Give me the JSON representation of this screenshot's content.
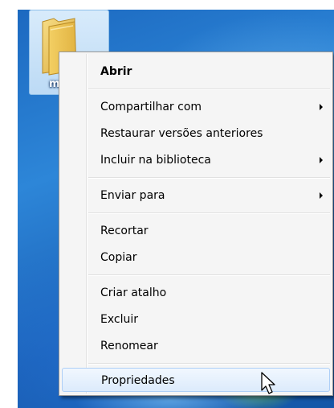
{
  "desktop": {
    "folder_label": "mú",
    "folder_icon": "folder-icon"
  },
  "menu": {
    "items": [
      {
        "label": "Abrir",
        "bold": true
      },
      {
        "label": "Compartilhar com",
        "submenu": true
      },
      {
        "label": "Restaurar versões anteriores"
      },
      {
        "label": "Incluir na biblioteca",
        "submenu": true
      },
      {
        "label": "Enviar para",
        "submenu": true
      },
      {
        "label": "Recortar"
      },
      {
        "label": "Copiar"
      },
      {
        "label": "Criar atalho"
      },
      {
        "label": "Excluir"
      },
      {
        "label": "Renomear"
      },
      {
        "label": "Propriedades",
        "highlighted": true
      }
    ]
  },
  "cursor": {
    "icon": "arrow-pointer-icon"
  },
  "colors": {
    "menu_background": "#f5f5f5",
    "highlight": "#dcebfc",
    "highlight_border": "#aecff7",
    "desktop_blue": "#2d86d8"
  }
}
